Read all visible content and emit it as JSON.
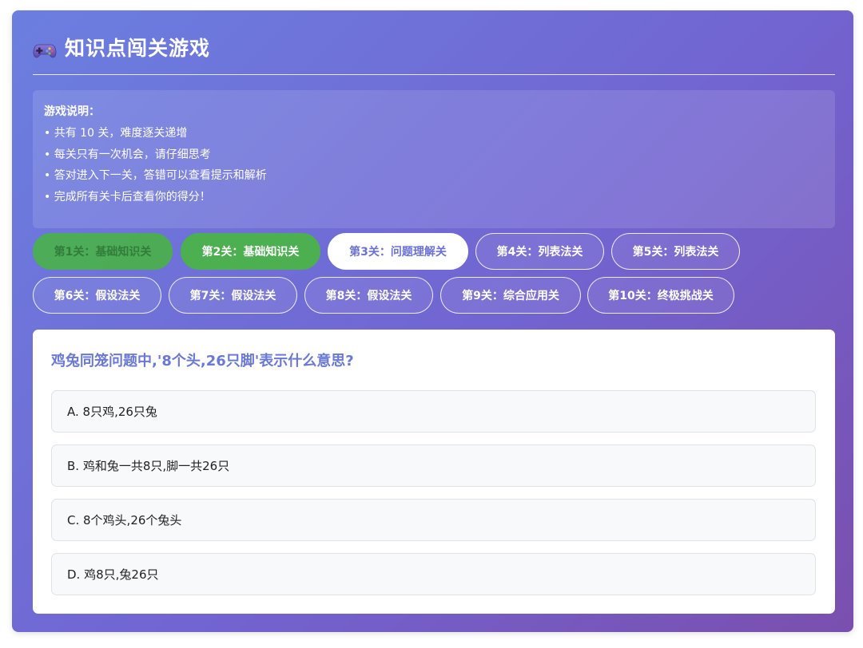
{
  "header": {
    "title": "知识点闯关游戏",
    "icon": "game-controller-icon"
  },
  "instructions": {
    "title": "游戏说明：",
    "rules": [
      "• 共有 10 关，难度逐关递增",
      "• 每关只有一次机会，请仔细思考",
      "• 答对进入下一关，答错可以查看提示和解析",
      "• 完成所有关卡后查看你的得分！"
    ]
  },
  "levels": [
    {
      "label": "第1关：基础知识关",
      "state": "completed-faded"
    },
    {
      "label": "第2关：基础知识关",
      "state": "completed"
    },
    {
      "label": "第3关：问题理解关",
      "state": "current"
    },
    {
      "label": "第4关：列表法关",
      "state": "locked"
    },
    {
      "label": "第5关：列表法关",
      "state": "locked"
    },
    {
      "label": "第6关：假设法关",
      "state": "locked"
    },
    {
      "label": "第7关：假设法关",
      "state": "locked"
    },
    {
      "label": "第8关：假设法关",
      "state": "locked"
    },
    {
      "label": "第9关：综合应用关",
      "state": "locked"
    },
    {
      "label": "第10关：终极挑战关",
      "state": "locked"
    }
  ],
  "question": {
    "text": "鸡兔同笼问题中,'8个头,26只脚'表示什么意思?",
    "options": [
      "A. 8只鸡,26只兔",
      "B. 鸡和兔一共8只,脚一共26只",
      "C. 8个鸡头,26个兔头",
      "D. 鸡8只,兔26只"
    ]
  },
  "colors": {
    "gradient_start": "#6b7fe0",
    "gradient_end": "#7a4fae",
    "completed": "#4caf50",
    "question_text": "#6a78d8"
  }
}
